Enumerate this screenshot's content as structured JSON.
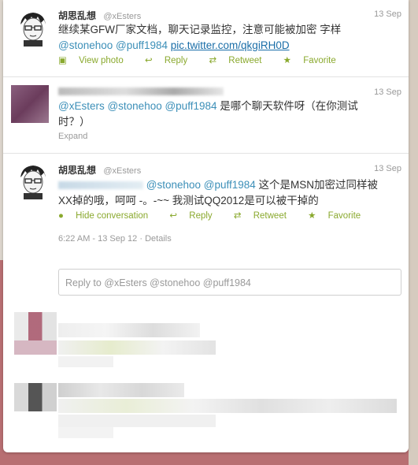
{
  "tweets": [
    {
      "name": "胡思乱想",
      "handle": "@xEsters",
      "time": "13 Sep",
      "text_main": "继续某GFW厂家文档，聊天记录监控，注意可能被加密 字样",
      "mentions": "@stonehoo @puff1984",
      "link": "pic.twitter.com/qkgiRH0D",
      "actions": [
        "View photo",
        "Reply",
        "Retweet",
        "Favorite"
      ]
    },
    {
      "time": "13 Sep",
      "mentions": "@xEsters @stonehoo @puff1984",
      "text_main": "是哪个聊天软件呀（在你测试",
      "text_cont": "时？）",
      "expand": "Expand"
    },
    {
      "name": "胡思乱想",
      "handle": "@xEsters",
      "time": "13 Sep",
      "mentions": "@stonehoo @puff1984",
      "text_main": "这个是MSN加密过同样被",
      "text_cont": "XX掉的哦，呵呵 -。-~~ 我测试QQ2012是可以被干掉的",
      "actions": [
        "Hide conversation",
        "Reply",
        "Retweet",
        "Favorite"
      ],
      "timestamp": "6:22 AM - 13 Sep 12",
      "details": "Details"
    }
  ],
  "reply_placeholder": "Reply to @xEsters @stonehoo @puff1984",
  "icons": {
    "photo": "photo-icon",
    "reply": "reply-icon",
    "retweet": "retweet-icon",
    "favorite": "star-icon",
    "conversation": "speech-bubble-icon"
  },
  "colors": {
    "accent": "#8aa92e",
    "mention": "#3c8fb8"
  }
}
